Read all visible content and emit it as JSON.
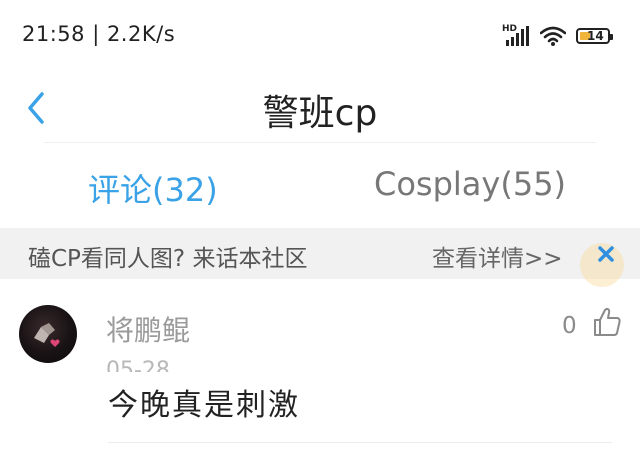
{
  "status_bar": {
    "time_speed": "21:58 | 2.2K/s",
    "network_badge": "HD",
    "battery_level": "14",
    "icons": [
      "signal-icon",
      "wifi-icon",
      "battery-icon"
    ]
  },
  "header": {
    "title": "警班cp",
    "back_icon": "chevron-left-icon"
  },
  "tabs": [
    {
      "label": "评论(32)",
      "active": true
    },
    {
      "label": "Cosplay(55)",
      "active": false
    }
  ],
  "banner": {
    "text": "磕CP看同人图? 来话本社区",
    "detail_label": "查看详情>>",
    "close_icon": "close-icon"
  },
  "comment": {
    "username": "将鹏鲲",
    "date": "05-28",
    "likes": "0",
    "text": "今晚真是刺激",
    "like_icon": "thumbs-up-icon"
  },
  "colors": {
    "accent": "#3aa2e6",
    "banner_bg": "#f1f1f1",
    "close": "#2f8fe0"
  }
}
